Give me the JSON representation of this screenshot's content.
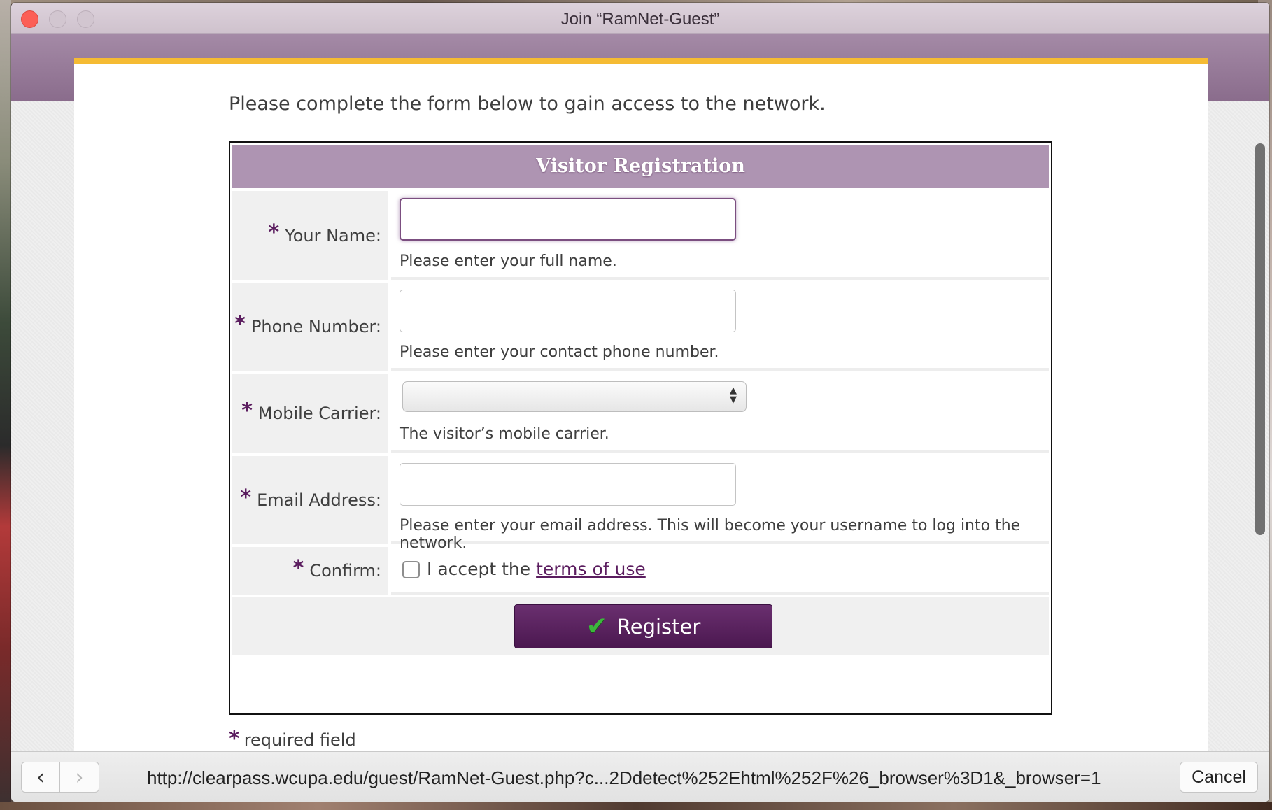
{
  "window": {
    "title": "Join “RamNet-Guest”"
  },
  "page": {
    "intro": "Please complete the form below to gain access to the network.",
    "form": {
      "header": "Visitor Registration",
      "fields": [
        {
          "label": "Your Name:",
          "value": "",
          "hint": "Please enter your full name."
        },
        {
          "label": "Phone Number:",
          "value": "",
          "hint": "Please enter your contact phone number."
        },
        {
          "label": "Mobile Carrier:",
          "value": "",
          "hint": "The visitor’s mobile carrier."
        },
        {
          "label": "Email Address:",
          "value": "",
          "hint": "Please enter your email address. This will become your username to log into the network."
        }
      ],
      "confirm": {
        "label": "Confirm:",
        "accept_text": "I accept the",
        "terms_link": "terms of use",
        "checked": false
      },
      "register_label": "Register",
      "required_star": "*",
      "required_note": "required field"
    }
  },
  "bottombar": {
    "url": "http://clearpass.wcupa.edu/guest/RamNet-Guest.php?c...2Ddetect%252Ehtml%252F%26_browser%3D1&_browser=1",
    "cancel_label": "Cancel"
  },
  "colors": {
    "accent_purple": "#5b1d5f",
    "header_purple": "#ae94b2",
    "gold_bar": "#f5bb33",
    "check_green": "#3cb83c"
  },
  "icons": {
    "back": "chevron-left-icon",
    "forward": "chevron-right-icon",
    "register": "checkmark-icon",
    "select": "updown-arrows-icon"
  }
}
